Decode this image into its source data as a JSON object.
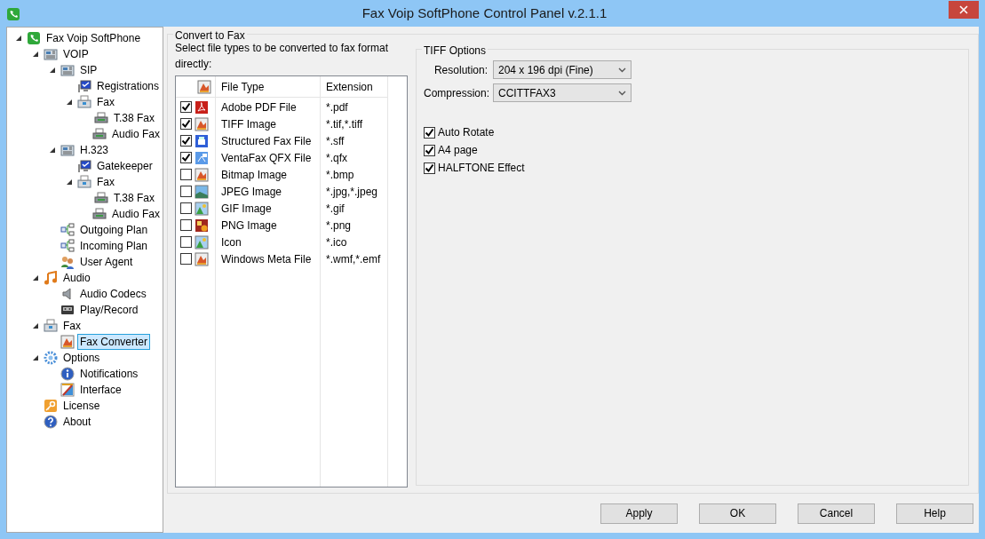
{
  "window": {
    "title": "Fax Voip SoftPhone Control Panel v.2.1.1"
  },
  "tree": [
    {
      "label": "Fax Voip SoftPhone",
      "kind": "phone",
      "expanded": true,
      "selected": false,
      "children": [
        {
          "label": "VOIP",
          "kind": "device",
          "expanded": true,
          "selected": false,
          "children": [
            {
              "label": "SIP",
              "kind": "device",
              "expanded": true,
              "selected": false,
              "children": [
                {
                  "label": "Registrations",
                  "kind": "monitor",
                  "selected": false
                },
                {
                  "label": "Fax",
                  "kind": "fax",
                  "expanded": true,
                  "selected": false,
                  "children": [
                    {
                      "label": "T.38 Fax",
                      "kind": "printer",
                      "selected": false
                    },
                    {
                      "label": "Audio Fax",
                      "kind": "printer",
                      "selected": false
                    }
                  ]
                }
              ]
            },
            {
              "label": "H.323",
              "kind": "device",
              "expanded": true,
              "selected": false,
              "children": [
                {
                  "label": "Gatekeeper",
                  "kind": "monitor",
                  "selected": false
                },
                {
                  "label": "Fax",
                  "kind": "fax",
                  "expanded": true,
                  "selected": false,
                  "children": [
                    {
                      "label": "T.38 Fax",
                      "kind": "printer",
                      "selected": false
                    },
                    {
                      "label": "Audio Fax",
                      "kind": "printer",
                      "selected": false
                    }
                  ]
                }
              ]
            },
            {
              "label": "Outgoing Plan",
              "kind": "plan",
              "selected": false
            },
            {
              "label": "Incoming Plan",
              "kind": "plan",
              "selected": false
            },
            {
              "label": "User Agent",
              "kind": "users",
              "selected": false
            }
          ]
        },
        {
          "label": "Audio",
          "kind": "music",
          "expanded": true,
          "selected": false,
          "children": [
            {
              "label": "Audio Codecs",
              "kind": "speaker",
              "selected": false
            },
            {
              "label": "Play/Record",
              "kind": "tape",
              "selected": false
            }
          ]
        },
        {
          "label": "Fax",
          "kind": "fax",
          "expanded": true,
          "selected": false,
          "children": [
            {
              "label": "Fax Converter",
              "kind": "image",
              "selected": true
            }
          ]
        },
        {
          "label": "Options",
          "kind": "gear",
          "expanded": true,
          "selected": false,
          "children": [
            {
              "label": "Notifications",
              "kind": "info",
              "selected": false
            },
            {
              "label": "Interface",
              "kind": "brush",
              "selected": false
            }
          ]
        },
        {
          "label": "License",
          "kind": "key",
          "selected": false
        },
        {
          "label": "About",
          "kind": "help",
          "selected": false
        }
      ]
    }
  ],
  "convert": {
    "title": "Convert to Fax",
    "hint": "Select file types to be converted to fax format directly:",
    "columns": [
      "File Type",
      "Extension"
    ],
    "rows": [
      {
        "checked": true,
        "kind": "pdf",
        "type": "Adobe PDF File",
        "extension": "*.pdf"
      },
      {
        "checked": true,
        "kind": "image",
        "type": "TIFF Image",
        "extension": "*.tif,*.tiff"
      },
      {
        "checked": true,
        "kind": "sff",
        "type": "Structured Fax File",
        "extension": "*.sff"
      },
      {
        "checked": true,
        "kind": "qfx",
        "type": "VentaFax QFX File",
        "extension": "*.qfx"
      },
      {
        "checked": false,
        "kind": "image",
        "type": "Bitmap Image",
        "extension": "*.bmp"
      },
      {
        "checked": false,
        "kind": "photo",
        "type": "JPEG Image",
        "extension": "*.jpg,*.jpeg"
      },
      {
        "checked": false,
        "kind": "picture",
        "type": "GIF Image",
        "extension": "*.gif"
      },
      {
        "checked": false,
        "kind": "png",
        "type": "PNG Image",
        "extension": "*.png"
      },
      {
        "checked": false,
        "kind": "picture",
        "type": "Icon",
        "extension": "*.ico"
      },
      {
        "checked": false,
        "kind": "image",
        "type": "Windows Meta File",
        "extension": "*.wmf,*.emf"
      }
    ]
  },
  "tiff_options": {
    "title": "TIFF Options",
    "fields": [
      {
        "label": "Resolution:",
        "value": "204 x 196 dpi (Fine)"
      },
      {
        "label": "Compression:",
        "value": "CCITTFAX3"
      }
    ],
    "checkboxes": [
      {
        "label": "Auto Rotate",
        "checked": true
      },
      {
        "label": "A4 page",
        "checked": true
      },
      {
        "label": "HALFTONE Effect",
        "checked": true
      }
    ]
  },
  "buttons": [
    "Apply",
    "OK",
    "Cancel",
    "Help"
  ]
}
